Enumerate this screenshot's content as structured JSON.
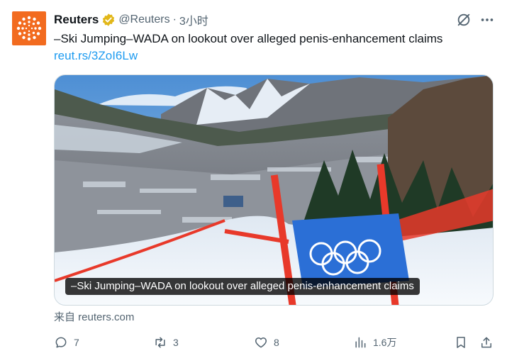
{
  "account": {
    "name": "Reuters",
    "handle": "@Reuters",
    "separator": "·",
    "time": "3小时",
    "verified_icon": "gold-verified-badge",
    "avatar_color": "#f26b1f"
  },
  "tweet": {
    "text": "–Ski Jumping–WADA on lookout over alleged penis-enhancement claims",
    "link": "reut.rs/3ZoI6Lw"
  },
  "card": {
    "caption": "–Ski Jumping–WADA on lookout over alleged penis-enhancement claims",
    "source": "来自 reuters.com"
  },
  "actions": {
    "replies": "7",
    "reposts": "3",
    "likes": "8",
    "views": "1.6万"
  },
  "colors": {
    "link": "#1d9bf0",
    "muted": "#536471",
    "verified": "#e2b719",
    "gate_blue": "#2b6fd6",
    "fence_red": "#e8392a"
  }
}
